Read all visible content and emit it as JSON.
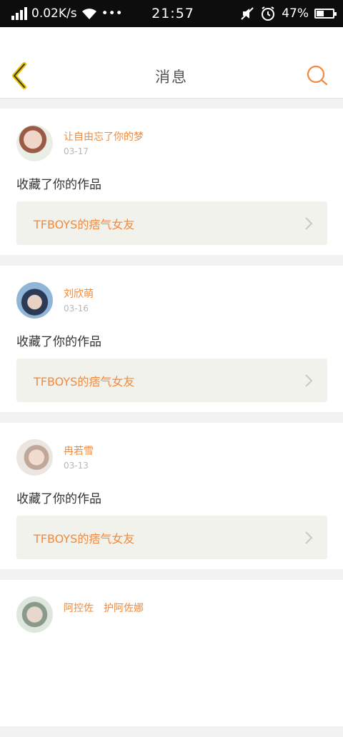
{
  "status_bar": {
    "speed": "0.02K/s",
    "dots": "•••",
    "time": "21:57",
    "battery_text": "47%",
    "battery_level": 0.47
  },
  "header": {
    "title": "消息"
  },
  "colors": {
    "accent": "#f08a3e",
    "back_icon": "#e6c200",
    "card_bg": "#f2f2ec"
  },
  "messages": [
    {
      "user": "让自由忘了你的梦",
      "date": "03-17",
      "action": "收藏了你的作品",
      "work": "TFBOYS的痞气女友"
    },
    {
      "user": "刘欣萌",
      "date": "03-16",
      "action": "收藏了你的作品",
      "work": "TFBOYS的痞气女友"
    },
    {
      "user": "冉若雪",
      "date": "03-13",
      "action": "收藏了你的作品",
      "work": "TFBOYS的痞气女友"
    },
    {
      "user": "阿控佐　护阿佐娜",
      "date": "",
      "action": "",
      "work": ""
    }
  ]
}
